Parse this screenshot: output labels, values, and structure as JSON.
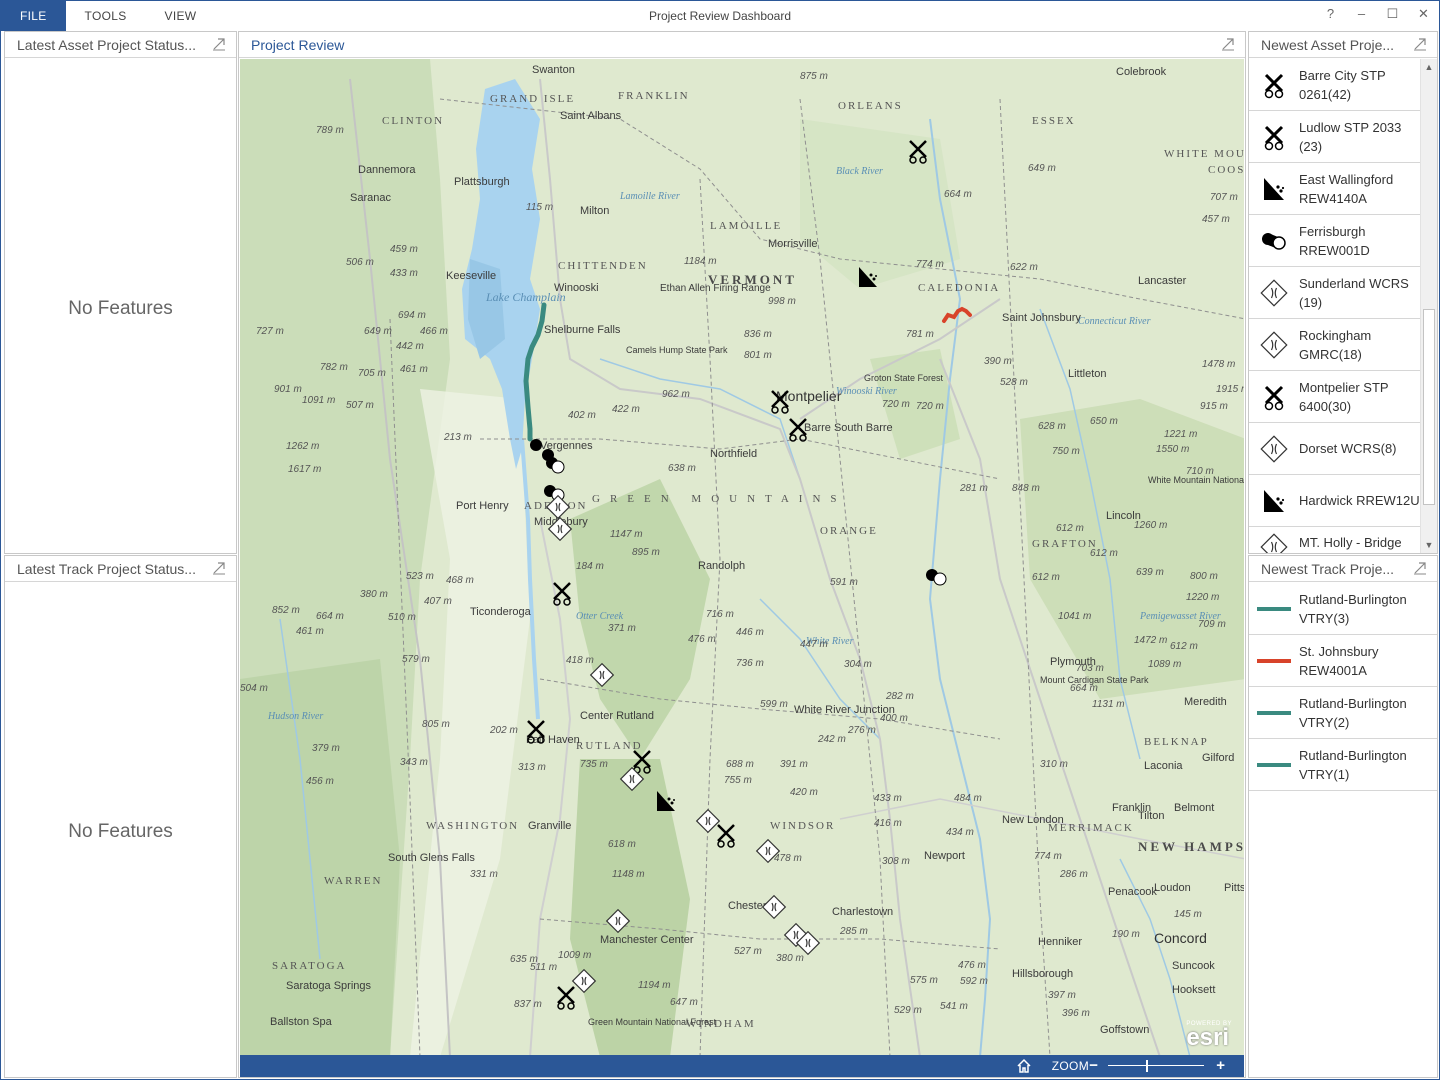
{
  "app": {
    "title": "Project Review Dashboard",
    "menu": [
      "FILE",
      "TOOLS",
      "VIEW"
    ],
    "window_controls": [
      "?",
      "–",
      "☐",
      "✕"
    ]
  },
  "colors": {
    "accent": "#2b5797",
    "track_teal": "#3a8a80",
    "track_red": "#d8432a"
  },
  "left": {
    "asset_status": {
      "title": "Latest Asset Project Status...",
      "empty": "No Features"
    },
    "track_status": {
      "title": "Latest Track Project Status...",
      "empty": "No Features"
    }
  },
  "map": {
    "title": "Project Review",
    "toolbar": {
      "zoom_label": "ZOOM",
      "zoom_minus": "−",
      "zoom_plus": "+",
      "home_icon": "home-icon"
    },
    "attribution": {
      "powered": "POWERED BY",
      "brand": "esri"
    },
    "labels": {
      "places": [
        "Swanton",
        "Saint Albans",
        "Plattsburgh",
        "Dannemora",
        "Saranac",
        "Milton",
        "Winooski",
        "Keeseville",
        "Shelburne Falls",
        "Morrisville",
        "Saint Johnsbury",
        "Lancaster",
        "Vergennes",
        "Port Henry",
        "Middlebury",
        "Northfield",
        "Barre South Barre",
        "Randolph",
        "Ticonderoga",
        "Center Rutland",
        "Fair Haven",
        "Granville",
        "South Glens Falls",
        "White River Junction",
        "Chester",
        "Charlestown",
        "Newport",
        "New London",
        "Franklin",
        "Tilton",
        "Belmont",
        "Laconia",
        "Gilford",
        "Plymouth",
        "Littleton",
        "Lincoln",
        "Meredith",
        "Penacook",
        "Loudon",
        "Pitts",
        "Henniker",
        "Hillsborough",
        "Suncook",
        "Hooksett",
        "Goffstown",
        "Saratoga Springs",
        "Ballston Spa",
        "Manchester Center",
        "Colebrook",
        "Ethan Allen Firing Range",
        "Camels Hump State Park",
        "Groton State Forest",
        "Green Mountain National Forest",
        "Mount Cardigan State Park",
        "White Mountain National Forest"
      ],
      "regions": [
        "GRAND ISLE",
        "FRANKLIN",
        "ORLEANS",
        "ESSEX",
        "CLINTON",
        "LAMOILLE",
        "CHITTENDEN",
        "CALEDONIA",
        "ADDISON",
        "ORANGE",
        "RUTLAND",
        "WINDSOR",
        "WASHINGTON",
        "WARREN",
        "SARATOGA",
        "WINDHAM",
        "MERRIMACK",
        "BELKNAP",
        "GRAFTON",
        "COOS",
        "WHITE MOU"
      ],
      "state": "VERMONT",
      "state_nh": "NEW HAMPSHIRE",
      "mountains": "GREEN MOUNTAINS",
      "cities": [
        "Montpelier",
        "Concord"
      ],
      "waters": [
        "Lake Champlain",
        "Lamoille River",
        "Black River",
        "Winooski River",
        "White River",
        "Connecticut River",
        "Hudson River",
        "Otter Creek",
        "Pemigewasset River"
      ],
      "elevations": [
        "875 m",
        "789 m",
        "115 m",
        "459 m",
        "506 m",
        "433 m",
        "694 m",
        "727 m",
        "649 m",
        "466 m",
        "442 m",
        "782 m",
        "705 m",
        "461 m",
        "901 m",
        "1091 m",
        "507 m",
        "1262 m",
        "1617 m",
        "213 m",
        "1184 m",
        "998 m",
        "836 m",
        "801 m",
        "402 m",
        "422 m",
        "962 m",
        "1147 m",
        "895 m",
        "638 m",
        "523 m",
        "468 m",
        "380 m",
        "407 m",
        "852 m",
        "664 m",
        "510 m",
        "461 m",
        "579 m",
        "504 m",
        "805 m",
        "379 m",
        "456 m",
        "343 m",
        "202 m",
        "313 m",
        "735 m",
        "688 m",
        "755 m",
        "391 m",
        "420 m",
        "618 m",
        "478 m",
        "1148 m",
        "331 m",
        "635 m",
        "511 m",
        "1009 m",
        "837 m",
        "1194 m",
        "647 m",
        "527 m",
        "380 m",
        "649 m",
        "664 m",
        "774 m",
        "781 m",
        "622 m",
        "707 m",
        "457 m",
        "390 m",
        "528 m",
        "720 m",
        "628 m",
        "1915 m",
        "1221 m",
        "1550 m",
        "750 m",
        "848 m",
        "612 m",
        "281 m",
        "720 m",
        "433 m",
        "416 m",
        "484 m",
        "434 m",
        "308 m",
        "774 m",
        "286 m",
        "145 m",
        "190 m",
        "592 m",
        "575 m",
        "476 m",
        "529 m",
        "541 m",
        "397 m",
        "396 m",
        "591 m",
        "447 m",
        "304 m",
        "736 m",
        "599 m",
        "242 m",
        "276 m",
        "400 m",
        "282 m",
        "612 m",
        "1472 m",
        "1220 m",
        "639 m",
        "800 m",
        "1260 m",
        "650 m",
        "1478 m",
        "915 m",
        "710 m",
        "664 m",
        "310 m",
        "285 m",
        "612 m",
        "709 m",
        "703 m",
        "612 m",
        "371 m",
        "418 m",
        "184 m",
        "476 m",
        "716 m",
        "446 m",
        "1041 m",
        "1131 m",
        "1089 m"
      ]
    }
  },
  "right": {
    "asset_list": {
      "title": "Newest Asset Proje...",
      "items": [
        {
          "label": "Barre City STP 0261(42)",
          "icon": "railroad-crossing-icon"
        },
        {
          "label": "Ludlow STP 2033 (23)",
          "icon": "railroad-crossing-icon"
        },
        {
          "label": "East Wallingford REW4140A",
          "icon": "rockfall-icon"
        },
        {
          "label": "Ferrisburgh RREW001D",
          "icon": "culvert-icon"
        },
        {
          "label": "Sunderland WCRS (19)",
          "icon": "bridge-diamond-icon"
        },
        {
          "label": "Rockingham GMRC(18)",
          "icon": "bridge-diamond-icon"
        },
        {
          "label": "Montpelier STP 6400(30)",
          "icon": "railroad-crossing-icon"
        },
        {
          "label": "Dorset WCRS(8)",
          "icon": "bridge-diamond-icon"
        },
        {
          "label": "Hardwick RREW12U",
          "icon": "rockfall-icon"
        },
        {
          "label": "MT. Holly - Bridge",
          "icon": "bridge-diamond-icon"
        }
      ]
    },
    "track_list": {
      "title": "Newest Track Proje...",
      "items": [
        {
          "label": "Rutland-Burlington VTRY(3)",
          "color": "#3a8a80"
        },
        {
          "label": "St. Johnsbury REW4001A",
          "color": "#d8432a"
        },
        {
          "label": "Rutland-Burlington VTRY(2)",
          "color": "#3a8a80"
        },
        {
          "label": "Rutland-Burlington VTRY(1)",
          "color": "#3a8a80"
        }
      ]
    }
  }
}
